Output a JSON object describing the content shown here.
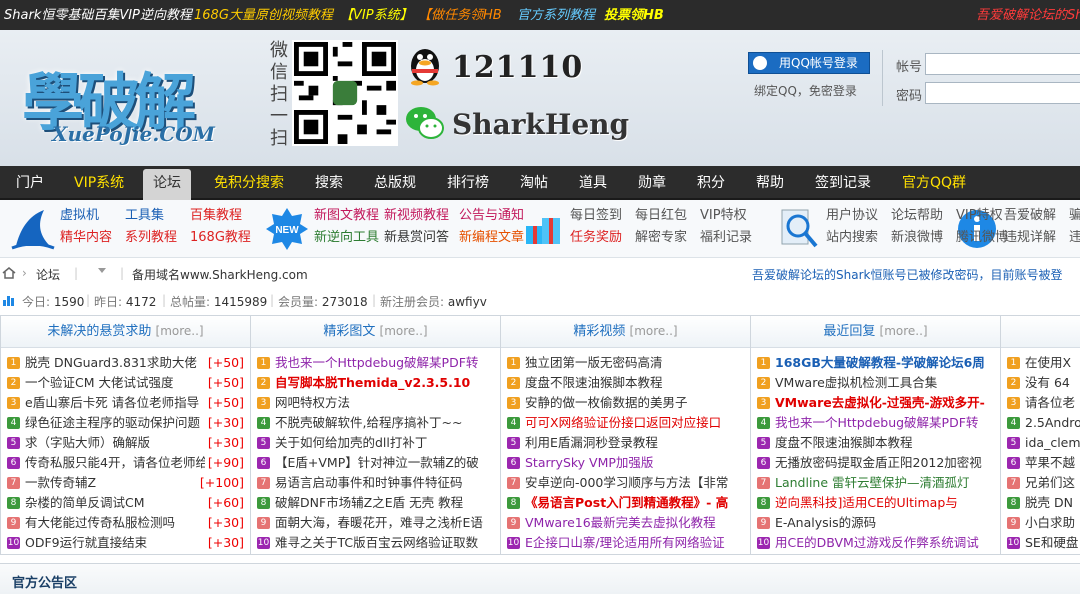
{
  "topbar": {
    "links": [
      {
        "text": "Shark恒零基础百集VIP逆向教程",
        "color": "#ffffff"
      },
      {
        "text": "168G大量原创视频教程",
        "color": "#ffcc00"
      },
      {
        "text": "【VIP系统】",
        "color": "#ffff00"
      },
      {
        "text": "【做任务领HB",
        "color": "#ff8800"
      },
      {
        "text": "官方系列教程",
        "color": "#66ccff"
      },
      {
        "text": "投票领HB",
        "color": "#ffff00"
      }
    ],
    "right_link": "吾爱破解论坛的Sh"
  },
  "header": {
    "logo_text": "學破解",
    "logo_sub": "XuePoJie.COM",
    "wechat_scan": "微信扫一扫",
    "qq_number": "121110",
    "wechat_name": "SharkHeng",
    "qq_login_label": "用QQ帐号登录",
    "qq_bind_text": "绑定QQ，免密登录",
    "account_label": "帐号",
    "password_label": "密码"
  },
  "nav": {
    "items": [
      {
        "label": "门户",
        "style": ""
      },
      {
        "label": "VIP系统",
        "style": "vip"
      },
      {
        "label": "论坛",
        "style": "active"
      },
      {
        "label": "免积分搜索",
        "style": "vip"
      },
      {
        "label": "搜索",
        "style": ""
      },
      {
        "label": "总版规",
        "style": ""
      },
      {
        "label": "排行榜",
        "style": ""
      },
      {
        "label": "淘帖",
        "style": ""
      },
      {
        "label": "道具",
        "style": ""
      },
      {
        "label": "勋章",
        "style": ""
      },
      {
        "label": "积分",
        "style": ""
      },
      {
        "label": "帮助",
        "style": ""
      },
      {
        "label": "签到记录",
        "style": ""
      },
      {
        "label": "官方QQ群",
        "style": "vip"
      }
    ]
  },
  "quicklinks": {
    "groups": [
      {
        "icon": "shark-fin-icon",
        "links": [
          {
            "text": "虚拟机",
            "color": "#1a5fb4"
          },
          {
            "text": "工具集",
            "color": "#1a5fb4"
          },
          {
            "text": "百集教程",
            "color": "#d22"
          },
          {
            "text": "精华内容",
            "color": "#d22"
          },
          {
            "text": "系列教程",
            "color": "#d22"
          },
          {
            "text": "168G教程",
            "color": "#d22"
          }
        ]
      },
      {
        "icon": "new-badge-icon",
        "links": [
          {
            "text": "新图文教程",
            "color": "#c2185b"
          },
          {
            "text": "新视频教程",
            "color": "#c2185b"
          },
          {
            "text": "公告与通知",
            "color": "#c2185b"
          },
          {
            "text": "新逆向工具",
            "color": "#2e7d32"
          },
          {
            "text": "新悬赏问答",
            "color": "#333"
          },
          {
            "text": "新编程文章",
            "color": "#e65100"
          }
        ]
      },
      {
        "icon": "gift-box-icon",
        "links": [
          {
            "text": "每日签到",
            "color": "#555"
          },
          {
            "text": "每日红包",
            "color": "#555"
          },
          {
            "text": "VIP特权",
            "color": "#555"
          },
          {
            "text": "任务奖励",
            "color": "#d22"
          },
          {
            "text": "解密专家",
            "color": "#555"
          },
          {
            "text": "福利记录",
            "color": "#555"
          }
        ]
      },
      {
        "icon": "magnifier-doc-icon",
        "links": [
          {
            "text": "用户协议",
            "color": "#555"
          },
          {
            "text": "论坛帮助",
            "color": "#555"
          },
          {
            "text": "VIP特权",
            "color": "#555"
          },
          {
            "text": "站内搜索",
            "color": "#555"
          },
          {
            "text": "新浪微博",
            "color": "#555"
          },
          {
            "text": "腾讯微博",
            "color": "#555"
          }
        ]
      },
      {
        "icon": "info-icon",
        "links": [
          {
            "text": "吾爱破解",
            "color": "#555"
          },
          {
            "text": "骗",
            "color": "#555"
          },
          {
            "text": "违规详解",
            "color": "#555"
          },
          {
            "text": "违",
            "color": "#555"
          }
        ]
      }
    ]
  },
  "breadcrumb": {
    "home": "论坛",
    "domain_text": "备用域名www.SharkHeng.com",
    "notice": "吾爱破解论坛的Shark恒账号已被修改密码，目前账号被登"
  },
  "stats": {
    "today_label": "今日:",
    "today": "1590",
    "yesterday_label": "昨日:",
    "yesterday": "4172",
    "posts_label": "总帖量:",
    "posts": "1415989",
    "members_label": "会员量:",
    "members": "273018",
    "newest_label": "新注册会员:",
    "newest": "awfiyv"
  },
  "columns": [
    {
      "title": "未解决的悬赏求助",
      "more": "[more..]",
      "items": [
        {
          "text": "脱壳 DNGuard3.831求助大佬",
          "color": "#333",
          "bold": false,
          "points": "[+50]"
        },
        {
          "text": "一个验证CM 大佬试试强度",
          "color": "#333",
          "bold": false,
          "points": "[+50]"
        },
        {
          "text": "e盾山寨后卡死 请各位老师指导",
          "color": "#333",
          "bold": false,
          "points": "[+50]"
        },
        {
          "text": "绿色征途主程序的驱动保护问题",
          "color": "#333",
          "bold": false,
          "points": "[+30]"
        },
        {
          "text": "求（字贴大师）确解版",
          "color": "#333",
          "bold": false,
          "points": "[+30]"
        },
        {
          "text": "传奇私服只能4开，请各位老师给",
          "color": "#333",
          "bold": false,
          "points": "[+90]"
        },
        {
          "text": "一款传奇辅Z",
          "color": "#333",
          "bold": false,
          "points": "[+100]"
        },
        {
          "text": "杂楼的简单反调试CM",
          "color": "#333",
          "bold": false,
          "points": "[+60]"
        },
        {
          "text": "有大佬能过传奇私服检测吗",
          "color": "#333",
          "bold": false,
          "points": "[+30]"
        },
        {
          "text": "ODF9运行就直接结束",
          "color": "#333",
          "bold": false,
          "points": "[+30]"
        }
      ]
    },
    {
      "title": "精彩图文",
      "more": "[more..]",
      "items": [
        {
          "text": "我也来一个Httpdebug破解某PDF转",
          "color": "#8e24aa",
          "bold": false
        },
        {
          "text": "自写脚本脱Themida_v2.3.5.10",
          "color": "#e00000",
          "bold": true
        },
        {
          "text": "网吧特权方法",
          "color": "#333",
          "bold": false
        },
        {
          "text": "不脱壳破解软件,给程序搞补丁~~",
          "color": "#333",
          "bold": false
        },
        {
          "text": "关于如何给加壳的dll打补丁",
          "color": "#333",
          "bold": false
        },
        {
          "text": "【E盾+VMP】针对神泣一款辅Z的破",
          "color": "#333",
          "bold": false
        },
        {
          "text": "易语言启动事件和时钟事件特征码",
          "color": "#333",
          "bold": false
        },
        {
          "text": "破解DNF市场辅Z之E盾 无壳 教程",
          "color": "#333",
          "bold": false
        },
        {
          "text": "面朝大海，春暖花开，难寻之浅析E语",
          "color": "#333",
          "bold": false
        },
        {
          "text": "难寻之关于TC版百宝云网络验证取数",
          "color": "#333",
          "bold": false
        }
      ]
    },
    {
      "title": "精彩视频",
      "more": "[more..]",
      "items": [
        {
          "text": "独立团第一版无密码高清",
          "color": "#333",
          "bold": false
        },
        {
          "text": "度盘不限速油猴脚本教程",
          "color": "#333",
          "bold": false
        },
        {
          "text": "安静的做一枚偷数据的美男子",
          "color": "#333",
          "bold": false
        },
        {
          "text": "可可X网络验证份接口返回对应接口",
          "color": "#e00000",
          "bold": false
        },
        {
          "text": "利用E盾漏洞秒登录教程",
          "color": "#333",
          "bold": false
        },
        {
          "text": "StarrySky VMP加强版",
          "color": "#8e24aa",
          "bold": false
        },
        {
          "text": "安卓逆向-000学习顺序与方法【非常",
          "color": "#333",
          "bold": false
        },
        {
          "text": "《易语言Post入门到精通教程》- 高",
          "color": "#e00000",
          "bold": true
        },
        {
          "text": "VMware16最新完美去虚拟化教程",
          "color": "#8e24aa",
          "bold": false
        },
        {
          "text": "E企接口山寨/理论适用所有网络验证",
          "color": "#8e24aa",
          "bold": false
        }
      ]
    },
    {
      "title": "最近回复",
      "more": "[more..]",
      "items": [
        {
          "text": "168GB大量破解教程-学破解论坛6周",
          "color": "#1a5fb4",
          "bold": true
        },
        {
          "text": "VMware虚拟机检测工具合集",
          "color": "#333",
          "bold": false
        },
        {
          "text": "VMware去虚拟化-过强壳-游戏多开-",
          "color": "#e00000",
          "bold": true
        },
        {
          "text": "我也来一个Httpdebug破解某PDF转",
          "color": "#8e24aa",
          "bold": false
        },
        {
          "text": "度盘不限速油猴脚本教程",
          "color": "#333",
          "bold": false
        },
        {
          "text": "无播放密码提取金盾正阳2012加密视",
          "color": "#333",
          "bold": false
        },
        {
          "text": "Landline 雷轩云壁保护—清酒孤灯",
          "color": "#2e7d32",
          "bold": false
        },
        {
          "text": "逆向黑科技]适用CE的Ultimap与",
          "color": "#e00000",
          "bold": false
        },
        {
          "text": "E-Analysis的源码",
          "color": "#333",
          "bold": false
        },
        {
          "text": "用CE的DBVM过游戏反作弊系统调试",
          "color": "#8e24aa",
          "bold": false
        }
      ]
    },
    {
      "title": "今",
      "more": "",
      "items": [
        {
          "text": "在使用X",
          "color": "#333",
          "bold": false
        },
        {
          "text": "没有 64",
          "color": "#333",
          "bold": false
        },
        {
          "text": "请各位老",
          "color": "#333",
          "bold": false
        },
        {
          "text": "2.5Andro",
          "color": "#333",
          "bold": false
        },
        {
          "text": "ida_clem",
          "color": "#333",
          "bold": false
        },
        {
          "text": "苹果不越",
          "color": "#333",
          "bold": false
        },
        {
          "text": "兄弟们这",
          "color": "#333",
          "bold": false
        },
        {
          "text": "脱壳 DN",
          "color": "#333",
          "bold": false
        },
        {
          "text": "小白求助",
          "color": "#333",
          "bold": false
        },
        {
          "text": "SE和硬盘",
          "color": "#333",
          "bold": false
        }
      ]
    }
  ],
  "notice_section": {
    "title": "官方公告区"
  },
  "rank_colors": [
    "#f0a020",
    "#f0a020",
    "#f0a020",
    "#3c9a3c",
    "#9c27b0",
    "#9c27b0",
    "#e57373",
    "#3c9a3c",
    "#e57373",
    "#9c27b0"
  ]
}
